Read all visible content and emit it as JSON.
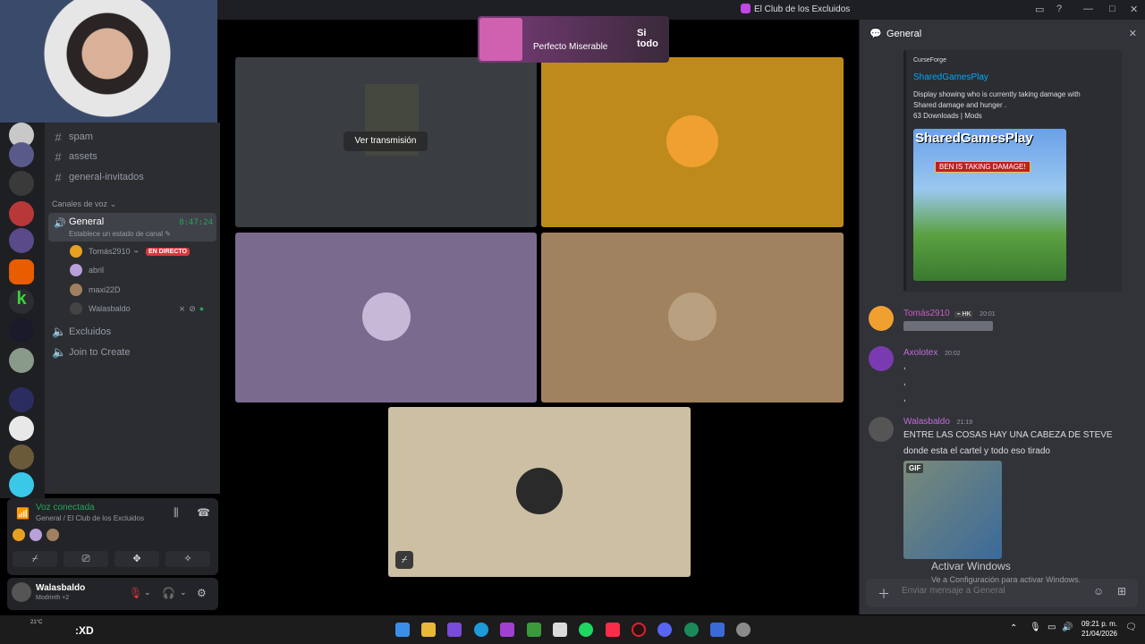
{
  "window": {
    "title": "El Club de los Excluidos"
  },
  "banner": {
    "subtitle": "Perfecto Miserable",
    "title": "Si todo"
  },
  "channels": {
    "text": [
      {
        "name": "spam"
      },
      {
        "name": "assets"
      },
      {
        "name": "general-invitados"
      }
    ],
    "voice_category": "Canales de voz",
    "voice": {
      "name": "General",
      "status": "Establece un estado de canal",
      "elapsed": "8:47:24"
    },
    "voice_users": [
      {
        "name": "Tomás2910",
        "badge": "EN DIRECTO"
      },
      {
        "name": "abril"
      },
      {
        "name": "maxi22D"
      },
      {
        "name": "Walasbaldo"
      }
    ],
    "other": [
      {
        "name": "Excluidos"
      },
      {
        "name": "Join to Create"
      }
    ]
  },
  "voice_panel": {
    "title": "Voz conectada",
    "subtitle": "General / El Club de los Excluidos"
  },
  "user_panel": {
    "name": "Walasbaldo",
    "activity": "Modrinth +2"
  },
  "stage": {
    "stream_button": "Ver transmisión"
  },
  "chat": {
    "title": "General",
    "embed": {
      "provider": "CurseForge",
      "title": "SharedGamesPlay",
      "desc1": "Display showing who is currently taking damage with",
      "desc2": "Shared damage and hunger .",
      "meta": "63 Downloads | Mods",
      "image_title": "SharedGamesPlay",
      "image_banner": "BEN IS TAKING DAMAGE!"
    },
    "messages": [
      {
        "user": "Tomás2910",
        "tag": "HK",
        "time": "20:01"
      },
      {
        "user": "Axolotex",
        "time": "20:02",
        "lines": [
          ",",
          ",",
          ","
        ]
      },
      {
        "user": "Walasbaldo",
        "time": "21:19",
        "line1": "ENTRE LAS COSAS HAY UNA CABEZA DE STEVE",
        "line2": "donde esta el cartel y todo eso tirado",
        "gif_label": "GIF"
      }
    ],
    "composer_placeholder": "Enviar mensaje a General"
  },
  "windows_notice": {
    "title": "Activar Windows",
    "subtitle": "Ve a Configuración para activar Windows."
  },
  "taskbar": {
    "weather": "21°C",
    "overlay_text": ":XD",
    "time": "09:21 p. m.",
    "date": "21/04/2026"
  },
  "colors": {
    "accent_green": "#23a55a",
    "live_red": "#da373c",
    "tile_gold": "#bf8a1c",
    "tile_lavender": "#7a6a8e",
    "tile_brown": "#a0825e",
    "tile_beige": "#cdbfa3"
  }
}
